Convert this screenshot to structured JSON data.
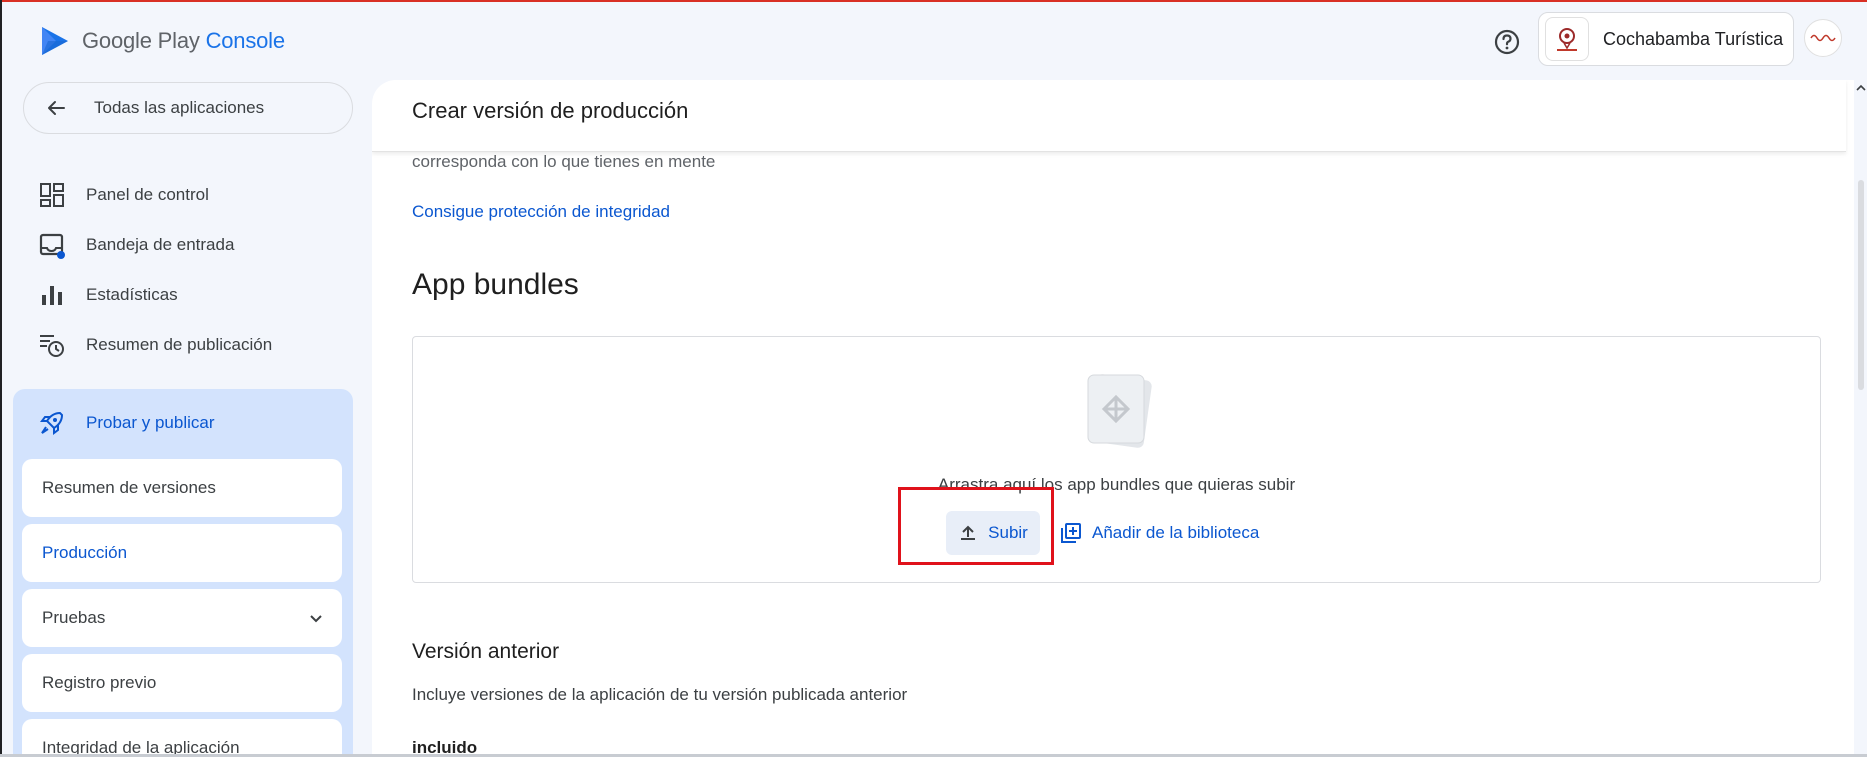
{
  "header": {
    "logo_brand": "Google Play",
    "logo_product": "Console",
    "account_name": "Cochabamba Turística"
  },
  "sidebar": {
    "back_label": "Todas las aplicaciones",
    "items": [
      {
        "label": "Panel de control",
        "icon": "dashboard-icon"
      },
      {
        "label": "Bandeja de entrada",
        "icon": "inbox-icon"
      },
      {
        "label": "Estadísticas",
        "icon": "bar-chart-icon"
      },
      {
        "label": "Resumen de publicación",
        "icon": "publishing-overview-icon"
      }
    ],
    "section": {
      "label": "Probar y publicar",
      "icon": "rocket-icon",
      "items": [
        {
          "label": "Resumen de versiones"
        },
        {
          "label": "Producción",
          "active": true
        },
        {
          "label": "Pruebas",
          "expandable": true
        },
        {
          "label": "Registro previo"
        },
        {
          "label": "Integridad de la aplicación"
        }
      ]
    }
  },
  "main": {
    "sticky_title": "Crear versión de producción",
    "cut_text": "corresponda con lo que tienes en mente",
    "integrity_link": "Consigue protección de integridad",
    "bundles_title": "App bundles",
    "drop_text": "Arrastra aquí los app bundles que quieras subir",
    "upload_label": "Subir",
    "library_label": "Añadir de la biblioteca",
    "previous_title": "Versión anterior",
    "previous_desc": "Incluye versiones de la aplicación de tu versión publicada anterior",
    "previous_included": "incluido"
  },
  "colors": {
    "accent": "#0b57d0",
    "section_bg": "#d3e3fd",
    "highlight": "#e0121b"
  }
}
